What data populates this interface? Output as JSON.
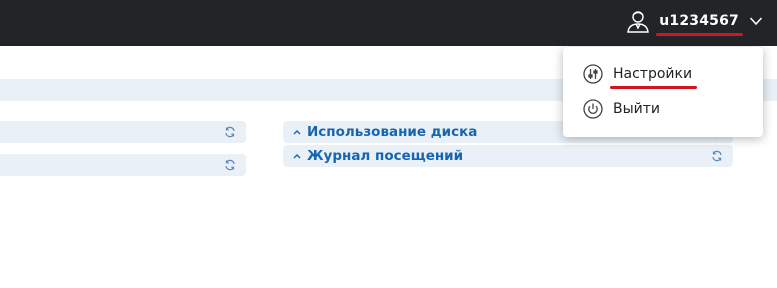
{
  "header": {
    "username": "u1234567",
    "user_icon": "user-avatar-icon",
    "dropdown_icon": "chevron-down-icon",
    "accent_color": "#d31521",
    "bar_color": "#222428"
  },
  "user_menu": {
    "items": [
      {
        "label": "Настройки",
        "icon": "sliders-icon"
      },
      {
        "label": "Выйти",
        "icon": "power-icon"
      }
    ]
  },
  "panels": {
    "left": [
      {
        "title": ""
      },
      {
        "title": ""
      }
    ],
    "right": [
      {
        "title": "Использование диска",
        "icon": "caret-up-icon"
      },
      {
        "title": "Журнал посещений",
        "icon": "caret-up-icon"
      }
    ],
    "title_color": "#1565b3",
    "background": "#e9f0f7"
  }
}
